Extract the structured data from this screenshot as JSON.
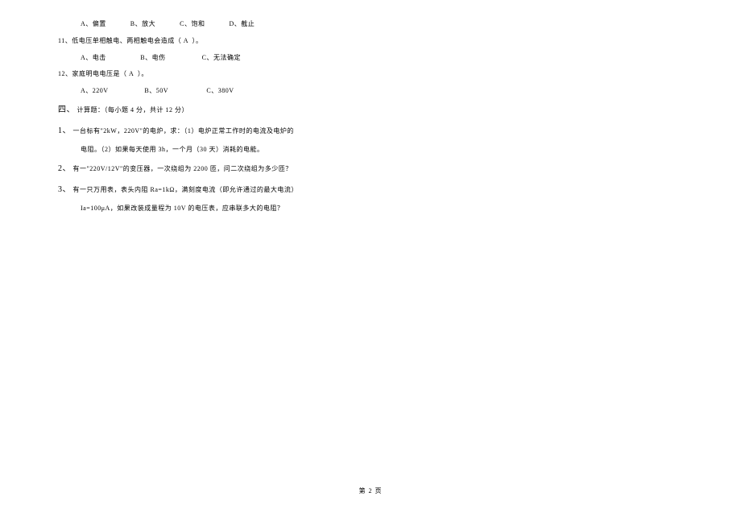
{
  "q10_options": "A、偏置            B、放大            C、饱和            D、截止",
  "q11_text": "11、低电压单相触电、两相触电会造成（ A  ）。",
  "q11_options": "A、电击                 B、电伤                  C、无法确定",
  "q12_text": "12、家庭明电电压是（ A  ）。",
  "q12_options": "A、220V                  B、50V                   C、380V",
  "section4_label": "四、",
  "section4_text": " 计算题：（每小题 4 分，共计 12 分）",
  "q1_num": "1、",
  "q1_text": " 一台标有\"2kW，220V\"的电炉，求：（1）电炉正常工作时的电流及电炉的",
  "q1_text2": "电阻。（2）如果每天使用 3h，一个月（30 天）消耗的电能。",
  "q2_num": "2、",
  "q2_text": " 有一\"220V/12V\"的变压器，一次绕组为 2200 匝，问二次绕组为多少匝？",
  "q3_num": "3、",
  "q3_text": " 有一只万用表，表头内阻 Ra=1kΩ，满刻度电流（即允许通过的最大电流）",
  "q3_text2": "Ia=100μA，如果改装成量程为 10V 的电压表，应串联多大的电阻？",
  "footer": "第  2  页"
}
